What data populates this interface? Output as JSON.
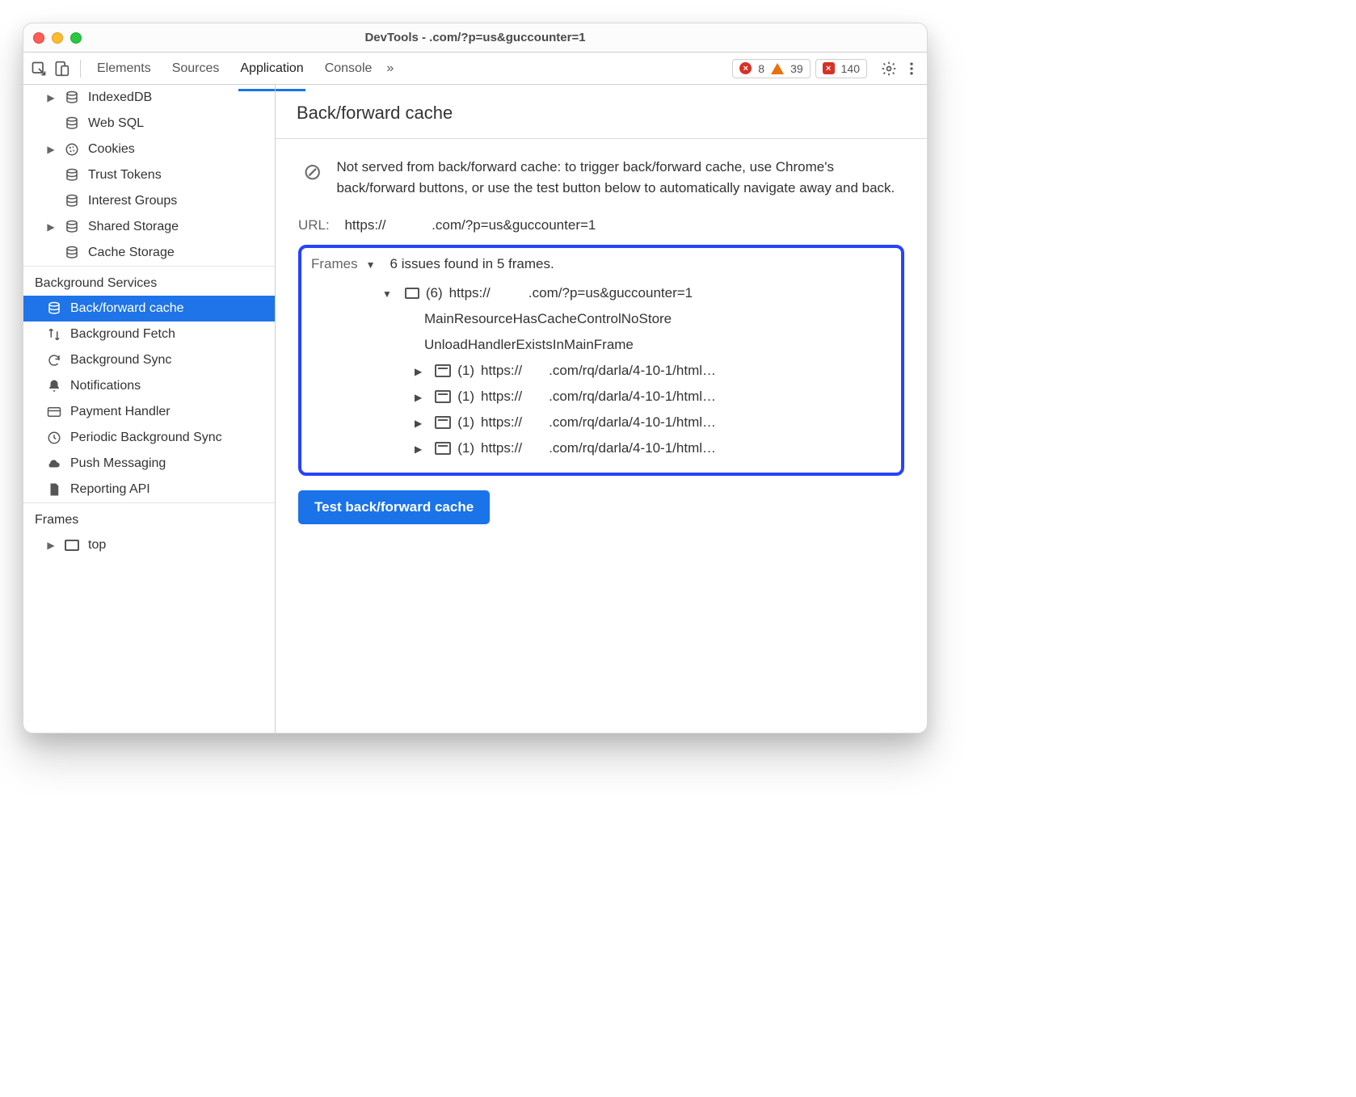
{
  "window": {
    "title": "DevTools -           .com/?p=us&guccounter=1"
  },
  "toolbar": {
    "tabs": [
      "Elements",
      "Sources",
      "Application",
      "Console"
    ],
    "active_tab_index": 2,
    "more_tabs_glyph": "»",
    "errors_count": "8",
    "warnings_count": "39",
    "issues_count": "140"
  },
  "sidebar": {
    "storage_items": [
      {
        "arrow": "▶",
        "icon": "db",
        "label": "IndexedDB"
      },
      {
        "arrow": "",
        "icon": "db",
        "label": "Web SQL"
      },
      {
        "arrow": "▶",
        "icon": "cookie",
        "label": "Cookies"
      },
      {
        "arrow": "",
        "icon": "db",
        "label": "Trust Tokens"
      },
      {
        "arrow": "",
        "icon": "db",
        "label": "Interest Groups"
      },
      {
        "arrow": "▶",
        "icon": "db",
        "label": "Shared Storage"
      },
      {
        "arrow": "",
        "icon": "db",
        "label": "Cache Storage"
      }
    ],
    "background_section": "Background Services",
    "background_items": [
      {
        "icon": "db",
        "label": "Back/forward cache",
        "selected": true
      },
      {
        "icon": "swap",
        "label": "Background Fetch"
      },
      {
        "icon": "sync",
        "label": "Background Sync"
      },
      {
        "icon": "bell",
        "label": "Notifications"
      },
      {
        "icon": "card",
        "label": "Payment Handler"
      },
      {
        "icon": "clock",
        "label": "Periodic Background Sync"
      },
      {
        "icon": "cloud",
        "label": "Push Messaging"
      },
      {
        "icon": "doc",
        "label": "Reporting API"
      }
    ],
    "frames_section": "Frames",
    "frames_items": [
      {
        "arrow": "▶",
        "icon": "frame",
        "label": "top"
      }
    ]
  },
  "pane": {
    "title": "Back/forward cache",
    "description": "Not served from back/forward cache: to trigger back/forward cache, use Chrome's back/forward buttons, or use the test button below to automatically navigate away and back.",
    "url_label": "URL:",
    "url_value": "https://            .com/?p=us&guccounter=1",
    "frames_label": "Frames",
    "frames_summary": "6 issues found in 5 frames.",
    "root_frame": {
      "count": "(6)",
      "url": "https://          .com/?p=us&guccounter=1",
      "reasons": [
        "MainResourceHasCacheControlNoStore",
        "UnloadHandlerExistsInMainFrame"
      ],
      "children": [
        {
          "count": "(1)",
          "url": "https://       .com/rq/darla/4-10-1/html…"
        },
        {
          "count": "(1)",
          "url": "https://       .com/rq/darla/4-10-1/html…"
        },
        {
          "count": "(1)",
          "url": "https://       .com/rq/darla/4-10-1/html…"
        },
        {
          "count": "(1)",
          "url": "https://       .com/rq/darla/4-10-1/html…"
        }
      ]
    },
    "test_button": "Test back/forward cache"
  }
}
